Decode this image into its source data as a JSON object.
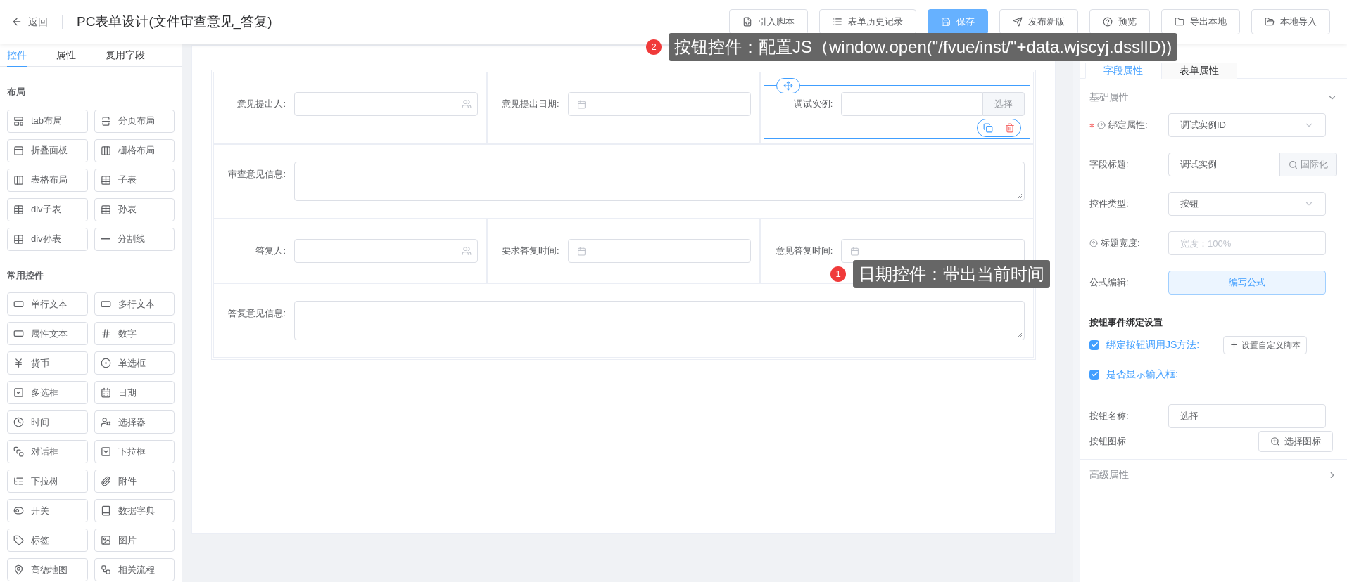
{
  "header": {
    "back_label": "返回",
    "title": "PC表单设计(文件审查意见_答复)",
    "buttons": [
      {
        "label": "引入脚本",
        "kind": "default"
      },
      {
        "label": "表单历史记录",
        "kind": "default"
      },
      {
        "label": "保存",
        "kind": "primary"
      },
      {
        "label": "发布新版",
        "kind": "default"
      },
      {
        "label": "预览",
        "kind": "default"
      },
      {
        "label": "导出本地",
        "kind": "default"
      },
      {
        "label": "本地导入",
        "kind": "default"
      }
    ]
  },
  "left_panel": {
    "tabs": [
      {
        "label": "控件",
        "selected": true
      },
      {
        "label": "属性",
        "selected": false
      },
      {
        "label": "复用字段",
        "selected": false
      }
    ],
    "sections": [
      {
        "title": "布局",
        "items": [
          "tab布局",
          "分页布局",
          "折叠面板",
          "栅格布局",
          "表格布局",
          "子表",
          "div子表",
          "孙表",
          "div孙表",
          "分割线"
        ]
      },
      {
        "title": "常用控件",
        "items": [
          "单行文本",
          "多行文本",
          "属性文本",
          "数字",
          "货币",
          "单选框",
          "多选框",
          "日期",
          "时间",
          "选择器",
          "对话框",
          "下拉框",
          "下拉树",
          "附件",
          "开关",
          "数据字典",
          "标签",
          "图片",
          "高德地图",
          "相关流程"
        ]
      }
    ]
  },
  "form": {
    "rows": [
      {
        "fields": [
          {
            "label": "意见提出人:",
            "kind": "user",
            "selected": false
          },
          {
            "label": "意见提出日期:",
            "kind": "date",
            "selected": false
          },
          {
            "label": "调试实例:",
            "kind": "button",
            "button_label": "选择",
            "selected": true
          }
        ]
      },
      {
        "fields": [
          {
            "label": "审查意见信息:",
            "kind": "textarea",
            "selected": false
          }
        ]
      },
      {
        "fields": [
          {
            "label": "答复人:",
            "kind": "user",
            "selected": false
          },
          {
            "label": "要求答复时间:",
            "kind": "date",
            "selected": false
          },
          {
            "label": "意见答复时间:",
            "kind": "date",
            "selected": false
          }
        ]
      },
      {
        "fields": [
          {
            "label": "答复意见信息:",
            "kind": "textarea",
            "selected": false
          }
        ]
      }
    ]
  },
  "annotations": [
    {
      "number": "2",
      "text": "按钮控件：配置JS（window.open(\"/fvue/inst/\"+data.wjscyj.dsslID))"
    },
    {
      "number": "1",
      "text": "日期控件：带出当前时间"
    }
  ],
  "right_panel": {
    "tabs": [
      {
        "label": "字段属性",
        "selected": true
      },
      {
        "label": "表单属性",
        "selected": false
      }
    ],
    "section_title": "基础属性",
    "properties": [
      {
        "label": "绑定属性:",
        "kind": "select",
        "value": "调试实例ID",
        "required": true,
        "help": true
      },
      {
        "label": "字段标题:",
        "kind": "addon",
        "value": "调试实例",
        "addon": "国际化",
        "required": false,
        "help": false
      },
      {
        "label": "控件类型:",
        "kind": "select",
        "value": "按钮",
        "required": false,
        "help": false
      },
      {
        "label": "标题宽度:",
        "kind": "input",
        "placeholder": "宽度：100%",
        "required": false,
        "help": true
      },
      {
        "label": "公式编辑:",
        "kind": "action",
        "value": "编写公式",
        "required": false,
        "help": false
      }
    ],
    "event_title": "按钮事件绑定设置",
    "checks": [
      {
        "label": "绑定按钮调用JS方法:",
        "checked": true,
        "action": "设置自定义脚本"
      },
      {
        "label": "是否显示输入框:",
        "checked": true
      }
    ],
    "button_name_label": "按钮名称:",
    "button_name": "选择",
    "button_icon_label": "按钮图标",
    "button_icon_action": "选择图标",
    "advanced_title": "高级属性"
  }
}
